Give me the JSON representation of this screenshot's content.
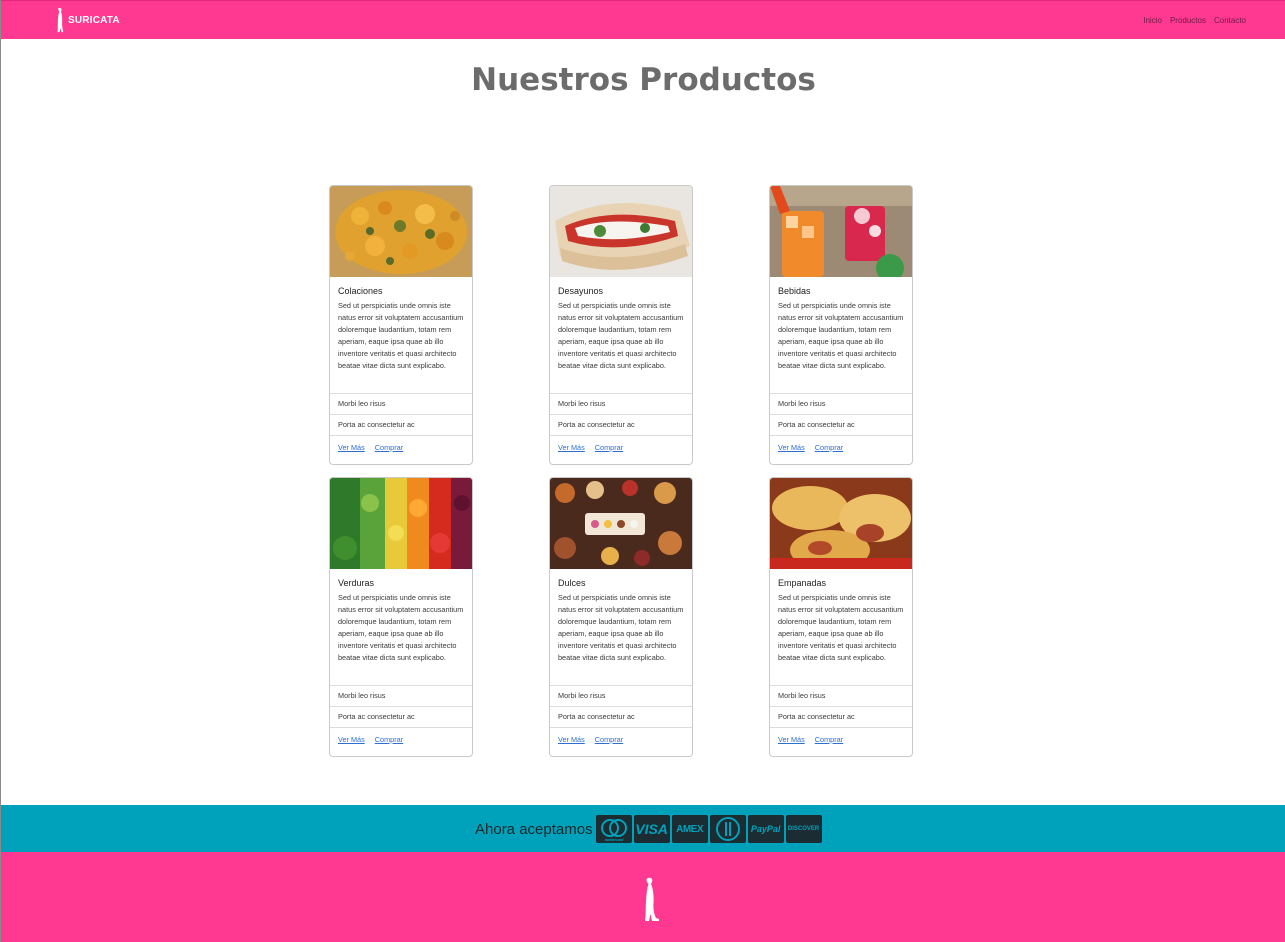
{
  "navbar": {
    "brand": "SURICATA",
    "links": [
      "Inicio",
      "Productos",
      "Contacto"
    ]
  },
  "page": {
    "title": "Nuestros Productos"
  },
  "cards": [
    {
      "title": "Colaciones",
      "text": "Sed ut perspiciatis unde omnis iste natus error sit voluptatem accusantium doloremque laudantium, totam rem aperiam, eaque ipsa quae ab illo inventore veritatis et quasi architecto beatae vitae dicta sunt explicabo.",
      "list": [
        "Morbi leo risus",
        "Porta ac consectetur ac"
      ],
      "link1": "Ver Más",
      "link2": "Comprar"
    },
    {
      "title": "Desayunos",
      "text": "Sed ut perspiciatis unde omnis iste natus error sit voluptatem accusantium doloremque laudantium, totam rem aperiam, eaque ipsa quae ab illo inventore veritatis et quasi architecto beatae vitae dicta sunt explicabo.",
      "list": [
        "Morbi leo risus",
        "Porta ac consectetur ac"
      ],
      "link1": "Ver Más",
      "link2": "Comprar"
    },
    {
      "title": "Bebidas",
      "text": "Sed ut perspiciatis unde omnis iste natus error sit voluptatem accusantium doloremque laudantium, totam rem aperiam, eaque ipsa quae ab illo inventore veritatis et quasi architecto beatae vitae dicta sunt explicabo.",
      "list": [
        "Morbi leo risus",
        "Porta ac consectetur ac"
      ],
      "link1": "Ver Más",
      "link2": "Comprar"
    },
    {
      "title": "Verduras",
      "text": "Sed ut perspiciatis unde omnis iste natus error sit voluptatem accusantium doloremque laudantium, totam rem aperiam, eaque ipsa quae ab illo inventore veritatis et quasi architecto beatae vitae dicta sunt explicabo.",
      "list": [
        "Morbi leo risus",
        "Porta ac consectetur ac"
      ],
      "link1": "Ver Más",
      "link2": "Comprar"
    },
    {
      "title": "Dulces",
      "text": "Sed ut perspiciatis unde omnis iste natus error sit voluptatem accusantium doloremque laudantium, totam rem aperiam, eaque ipsa quae ab illo inventore veritatis et quasi architecto beatae vitae dicta sunt explicabo.",
      "list": [
        "Morbi leo risus",
        "Porta ac consectetur ac"
      ],
      "link1": "Ver Más",
      "link2": "Comprar"
    },
    {
      "title": "Empanadas",
      "text": "Sed ut perspiciatis unde omnis iste natus error sit voluptatem accusantium doloremque laudantium, totam rem aperiam, eaque ipsa quae ab illo inventore veritatis et quasi architecto beatae vitae dicta sunt explicabo.",
      "list": [
        "Morbi leo risus",
        "Porta ac consectetur ac"
      ],
      "link1": "Ver Más",
      "link2": "Comprar"
    }
  ],
  "payment": {
    "text": "Ahora aceptamos",
    "methods": [
      "mastercard",
      "VISA",
      "AMEX",
      "Diners Club",
      "PayPal",
      "DISCOVER"
    ]
  },
  "icons": [
    "meerkat-logo-icon",
    "mastercard-icon",
    "visa-icon",
    "amex-icon",
    "diners-icon",
    "paypal-icon",
    "discover-icon",
    "meerkat-footer-icon"
  ],
  "colors": {
    "brand_pink": "#ff3892",
    "payment_teal": "#00a2bb",
    "title_gray": "#6c6c6c",
    "link_blue": "#2c6fd1"
  }
}
